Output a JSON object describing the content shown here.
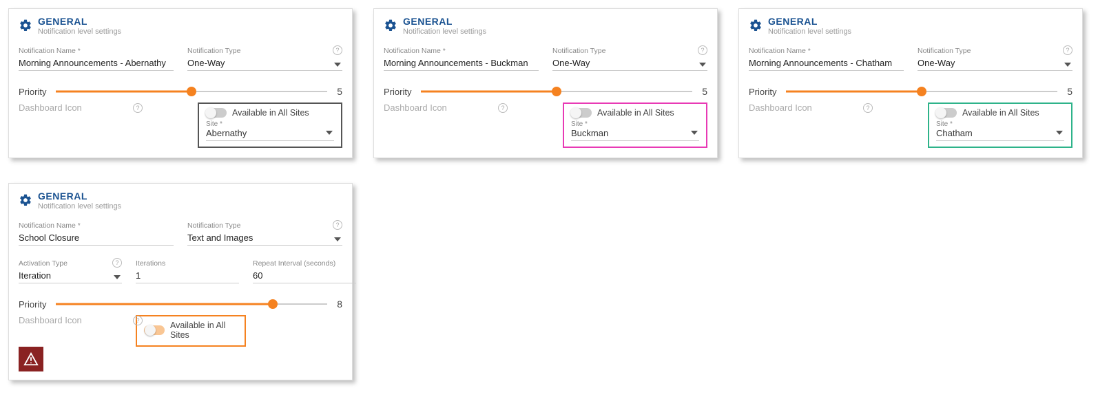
{
  "common": {
    "section_title": "GENERAL",
    "section_subtitle": "Notification level settings",
    "notification_name_label": "Notification Name *",
    "notification_type_label": "Notification Type",
    "priority_label": "Priority",
    "dashboard_icon_label": "Dashboard Icon",
    "available_label": "Available in All Sites",
    "site_label": "Site *",
    "help_symbol": "?"
  },
  "panels": {
    "a": {
      "name": "Morning Announcements - Abernathy",
      "type": "One-Way",
      "priority": "5",
      "priority_percent": 50,
      "site": "Abernathy",
      "avail_on": false
    },
    "b": {
      "name": "Morning Announcements - Buckman",
      "type": "One-Way",
      "priority": "5",
      "priority_percent": 50,
      "site": "Buckman",
      "avail_on": false
    },
    "c": {
      "name": "Morning Announcements - Chatham",
      "type": "One-Way",
      "priority": "5",
      "priority_percent": 50,
      "site": "Chatham",
      "avail_on": false
    },
    "d": {
      "name": "School Closure",
      "type": "Text and Images",
      "priority": "8",
      "priority_percent": 80,
      "activation_type_label": "Activation Type",
      "activation_type": "Iteration",
      "iterations_label": "Iterations",
      "iterations": "1",
      "repeat_label": "Repeat Interval (seconds)",
      "repeat": "60",
      "avail_on": true
    }
  }
}
